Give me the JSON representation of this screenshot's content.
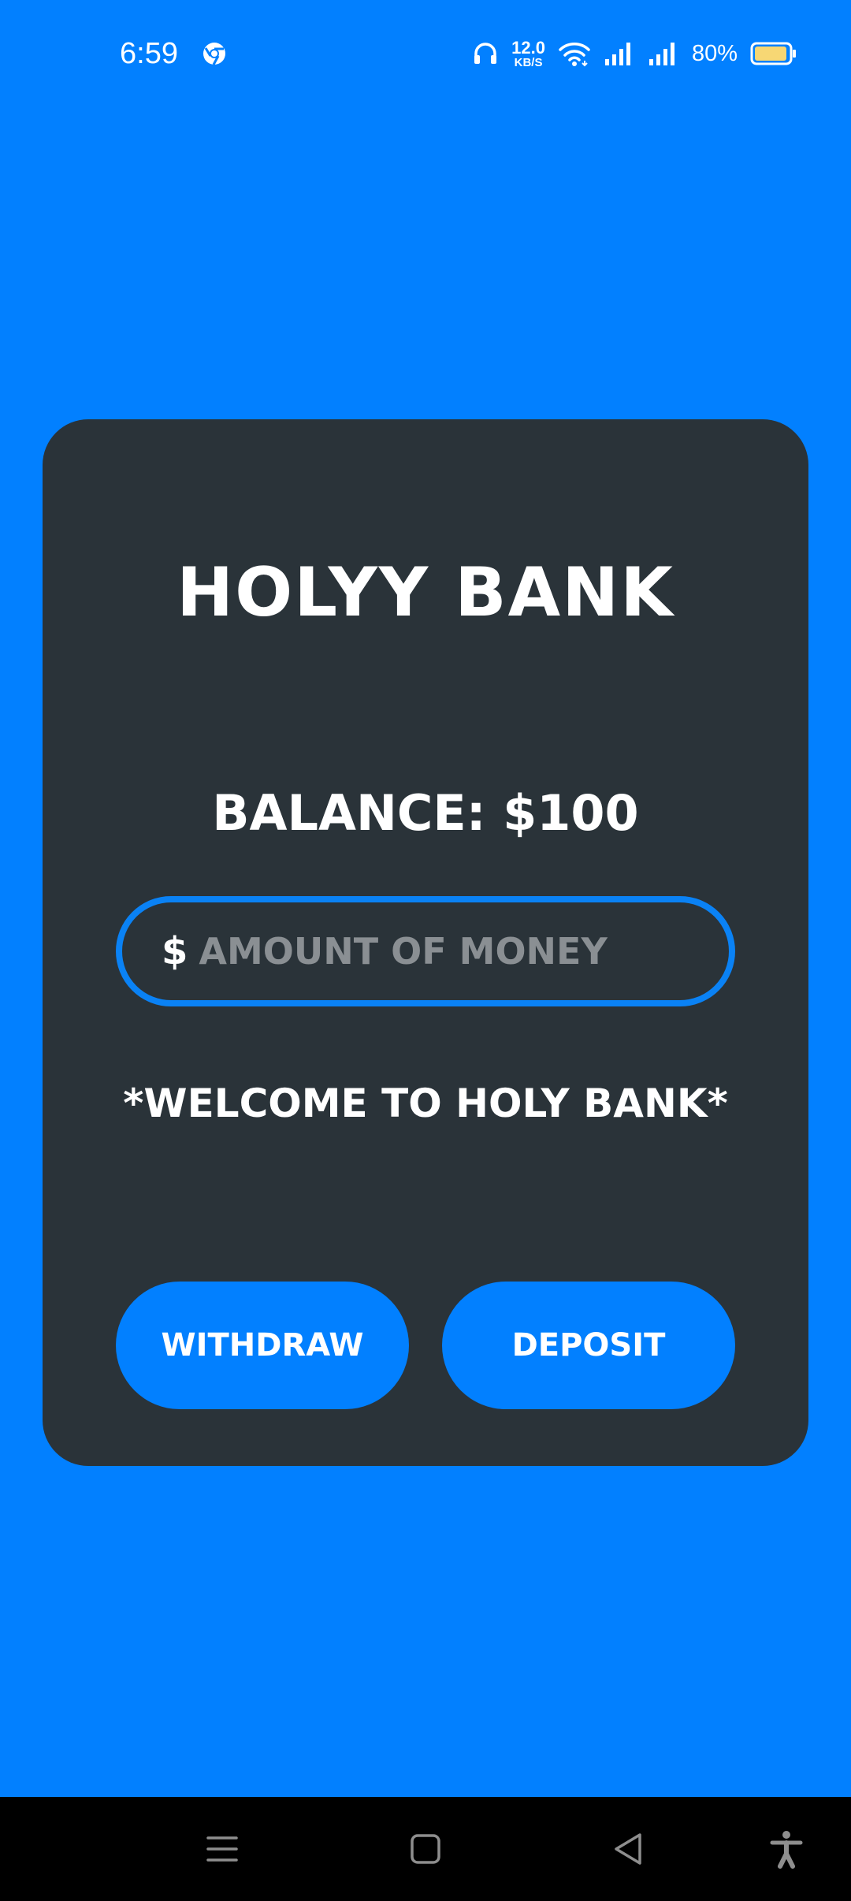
{
  "status_bar": {
    "time": "6:59",
    "speed_value": "12.0",
    "speed_unit": "KB/S",
    "battery_percent": "80%",
    "icons": [
      "chrome-icon",
      "headphones-icon",
      "wifi-icon",
      "signal-icon",
      "signal-icon",
      "battery-icon"
    ]
  },
  "card": {
    "title": "HOLYY BANK",
    "balance": "BALANCE: $100",
    "amount_field": {
      "prefix": "$",
      "placeholder": "AMOUNT OF MONEY",
      "value": ""
    },
    "welcome_message": "*WELCOME TO HOLY BANK*",
    "withdraw_label": "WITHDRAW",
    "deposit_label": "DEPOSIT"
  },
  "nav_bar": {
    "icons": [
      "menu-icon",
      "home-icon",
      "back-icon",
      "accessibility-icon"
    ]
  },
  "colors": {
    "background": "#0280FF",
    "card": "#2A3339",
    "accent": "#0A82F5",
    "text": "#FFFFFF",
    "placeholder": "#8A8F93",
    "nav_bar": "#000000"
  }
}
